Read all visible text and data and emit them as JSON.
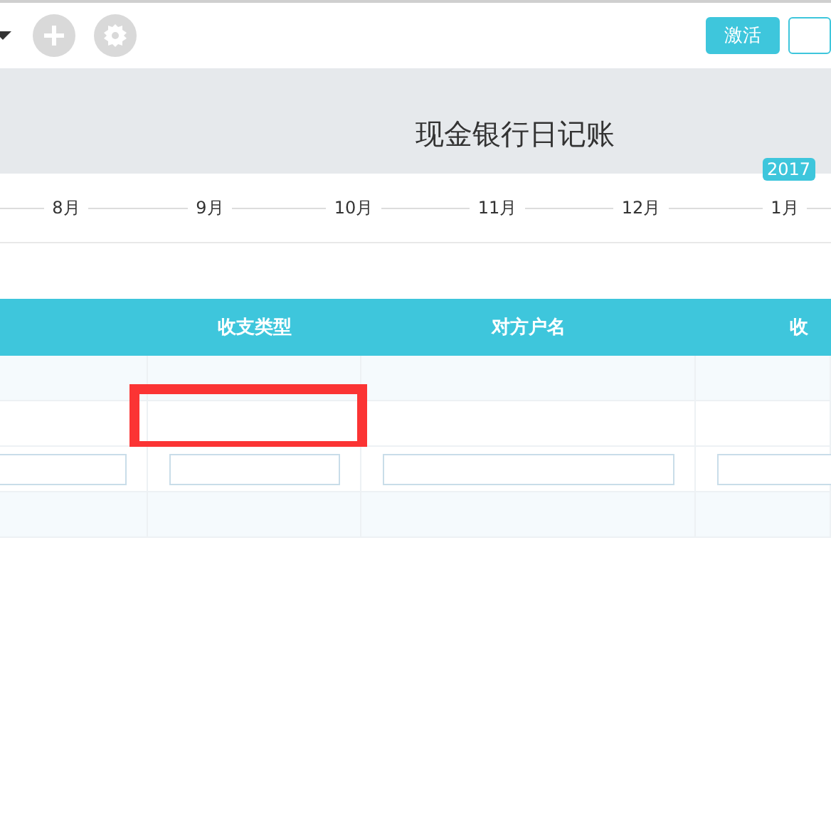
{
  "toolbar": {
    "icons": [
      {
        "kind": "add"
      },
      {
        "kind": "settings"
      }
    ],
    "buttons": [
      {
        "label": "激活",
        "kind": "primary"
      },
      {
        "kind": "outline"
      }
    ]
  },
  "title": "现金银行日记账",
  "timeline": {
    "year_badge": "2017",
    "months": [
      "8月",
      "9月",
      "10月",
      "11月",
      "12月",
      "1月"
    ]
  },
  "table": {
    "columns": [
      "收支类型",
      "对方户名",
      "收"
    ],
    "rows": [
      {
        "kind": "striped"
      },
      {
        "kind": "plain",
        "highlighted": true
      },
      {
        "kind": "inputs"
      },
      {
        "kind": "striped"
      }
    ]
  }
}
